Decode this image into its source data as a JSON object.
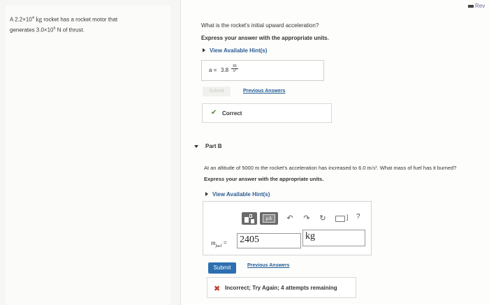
{
  "topbar": {
    "review_label": "Rev"
  },
  "problem": {
    "prefix": "A 2.2×10",
    "mass_exp": "4",
    "mass_unit": "kg",
    "mid": " rocket has a rocket motor that",
    "line2_pre": "generates 3.0×10",
    "thrust_exp": "5",
    "line2_post": " N of thrust."
  },
  "partA": {
    "question": "What is the rocket's initial upward acceleration?",
    "instruction": "Express your answer with the appropriate units.",
    "hints_label": "View Available Hint(s)",
    "answer_var": "a =",
    "answer_value": "3.8",
    "answer_unit_num": "m",
    "answer_unit_den": "s²",
    "submit_label": "Submit",
    "prev_answers_label": "Previous Answers",
    "feedback": "Correct"
  },
  "partB": {
    "title": "Part B",
    "question_pre": "At an altitude of 5000 ",
    "question_unit": "m",
    "question_mid": " the rocket's acceleration has increased to 6.0 ",
    "question_accel": "m/s²",
    "question_post": ". What mass of fuel has it burned?",
    "instruction": "Express your answer with the appropriate units.",
    "hints_label": "View Available Hint(s)",
    "toolbar": {
      "mu_label": "μA",
      "help_label": "?"
    },
    "answer_var": "m",
    "answer_sub": "fuel",
    "answer_eq": "=",
    "answer_value": "2405",
    "answer_unit": "kg",
    "submit_label": "Submit",
    "prev_answers_label": "Previous Answers",
    "feedback": "Incorrect; Try Again; 4 attempts remaining"
  }
}
